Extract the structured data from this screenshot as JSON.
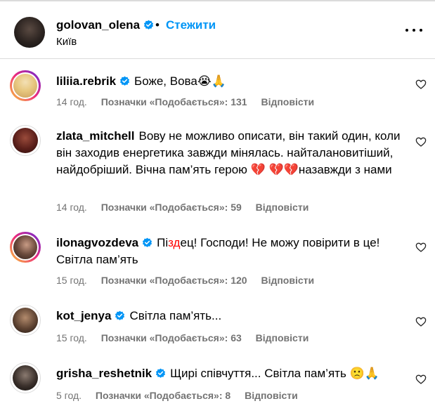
{
  "header": {
    "username": "golovan_olena",
    "separator": "•",
    "follow_label": "Стежити",
    "location": "Київ"
  },
  "comments": [
    {
      "username": "liliia.rebrik",
      "verified": true,
      "text": "Боже, Вова😭🙏",
      "time": "14 год.",
      "likes": "Позначки «Подобається»: 131",
      "reply": "Відповісти"
    },
    {
      "username": "zlata_mitchell",
      "verified": false,
      "text": "Вову не можливо описати, він такий один, коли він заходив енергетика завжди мінялась. найталановитіший, найдобріший. Вічна пам’ять герою 💔 💔💔назавжди з нами",
      "time": "14 год.",
      "likes": "Позначки «Подобається»: 59",
      "reply": "Відповісти"
    },
    {
      "username": "ilonagvozdeva",
      "verified": true,
      "text_before": "Пі",
      "text_censored": "зд",
      "text_after": "ец! Господи! Не можу повірити в це! Світла пам’ять",
      "time": "15 год.",
      "likes": "Позначки «Подобається»: 120",
      "reply": "Відповісти"
    },
    {
      "username": "kot_jenya",
      "verified": true,
      "text": "Світла пам’ять...",
      "time": "15 год.",
      "likes": "Позначки «Подобається»: 63",
      "reply": "Відповісти"
    },
    {
      "username": "grisha_reshetnik",
      "verified": true,
      "text": "Щирі співчуття... Світла пам’ять 🙁🙏",
      "time": "5 год.",
      "likes": "Позначки «Подобається»: 8",
      "reply": "Відповісти"
    }
  ],
  "colors": {
    "link": "#0095f6",
    "verified": "#0095f6",
    "meta": "#737373",
    "divider": "#dbdbdb"
  },
  "icons": {
    "verified": "verified-badge-icon",
    "like": "heart-outline-icon",
    "more": "more-options-icon"
  }
}
